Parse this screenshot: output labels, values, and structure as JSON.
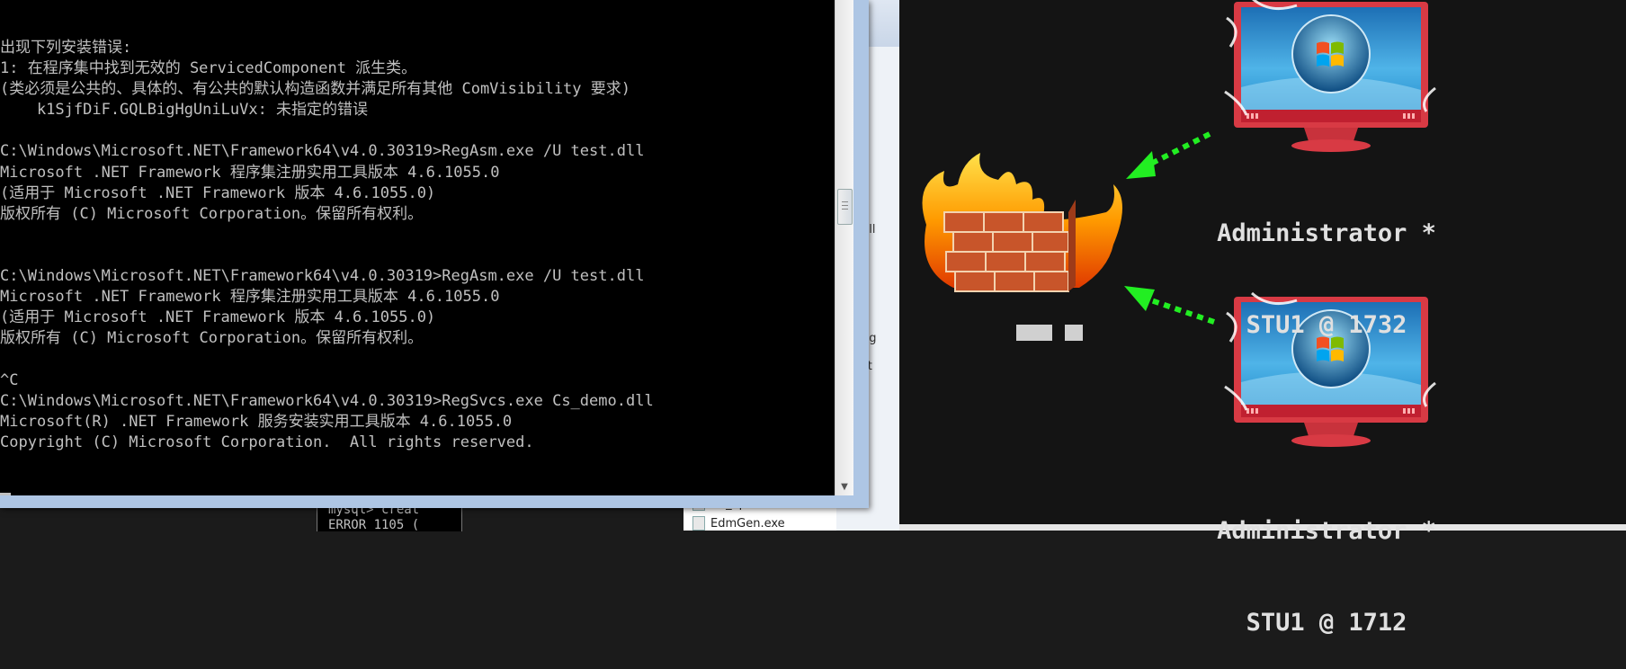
{
  "console": {
    "lines": [
      "出现下列安装错误:",
      "1: 在程序集中找到无效的 ServicedComponent 派生类。",
      "(类必须是公共的、具体的、有公共的默认构造函数并满足所有其他 ComVisibility 要求)",
      "    k1SjfDiF.GQLBigHgUniLuVx: 未指定的错误",
      "",
      "C:\\Windows\\Microsoft.NET\\Framework64\\v4.0.30319>RegAsm.exe /U test.dll",
      "Microsoft .NET Framework 程序集注册实用工具版本 4.6.1055.0",
      "(适用于 Microsoft .NET Framework 版本 4.6.1055.0)",
      "版权所有 (C) Microsoft Corporation。保留所有权利。",
      "",
      "",
      "C:\\Windows\\Microsoft.NET\\Framework64\\v4.0.30319>RegAsm.exe /U test.dll",
      "Microsoft .NET Framework 程序集注册实用工具版本 4.6.1055.0",
      "(适用于 Microsoft .NET Framework 版本 4.6.1055.0)",
      "版权所有 (C) Microsoft Corporation。保留所有权利。",
      "",
      "^C",
      "C:\\Windows\\Microsoft.NET\\Framework64\\v4.0.30319>RegSvcs.exe Cs_demo.dll",
      "Microsoft(R) .NET Framework 服务安装实用工具版本 4.6.1055.0",
      "Copyright (C) Microsoft Corporation.  All rights reserved."
    ]
  },
  "background": {
    "explorer_fragments": [
      "dll",
      "fig",
      "st"
    ],
    "mysql_lines": [
      "mysql> creat",
      "ERROR 1105 ("
    ],
    "file_rows": [
      "Dc_apicommand.dll",
      "EdmGen.exe"
    ]
  },
  "graph": {
    "colors": {
      "arrow": "#22ee22",
      "monitor": "#e0303a",
      "screen": "#2a8fd0"
    },
    "firewall_icon": "firewall-icon",
    "firewall_label": "",
    "sessions": [
      {
        "user": "Administrator *",
        "host": "STU1 @ 1732",
        "icon": "windows-monitor-icon"
      },
      {
        "user": "Administrator *",
        "host": "STU1 @ 1712",
        "icon": "windows-monitor-icon"
      }
    ]
  }
}
